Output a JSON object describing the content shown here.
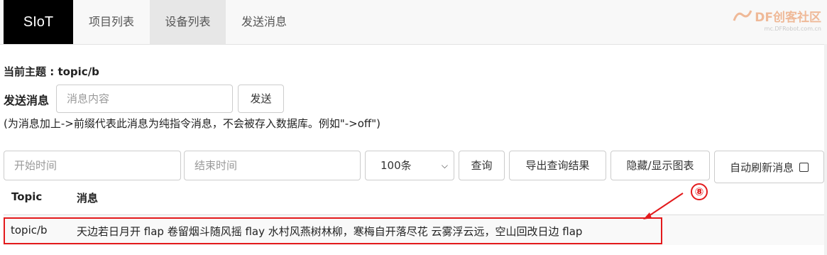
{
  "navbar": {
    "brand": "SIoT",
    "items": [
      {
        "label": "项目列表",
        "active": false
      },
      {
        "label": "设备列表",
        "active": true
      },
      {
        "label": "发送消息",
        "active": false
      }
    ],
    "watermark": {
      "text": "DF创客社区",
      "sub": "mc.DFRobot.com.cn"
    }
  },
  "topic": {
    "label": "当前主题 : topic/b"
  },
  "send": {
    "label": "发送消息",
    "input_placeholder": "消息内容",
    "button_label": "发送",
    "hint": "(为消息加上->前缀代表此消息为纯指令消息，不会被存入数据库。例如\"->off\")"
  },
  "query": {
    "start_placeholder": "开始时间",
    "end_placeholder": "结束时间",
    "limit_selected": "100条",
    "query_label": "查询",
    "export_label": "导出查询结果",
    "toggle_chart_label": "隐藏/显示图表",
    "auto_refresh_label": "自动刷新消息",
    "auto_refresh_checked": false
  },
  "table": {
    "headers": [
      "Topic",
      "消息"
    ],
    "rows": [
      {
        "topic": "topic/b",
        "message": "天边若日月开 flap 卷留烟斗随风摇 flay 水村风燕树林柳，寒梅自开落尽花 云雾浮云远，空山回改日边 flap"
      }
    ]
  },
  "annotation": {
    "label": "⑧",
    "color": "#e31a1c"
  }
}
